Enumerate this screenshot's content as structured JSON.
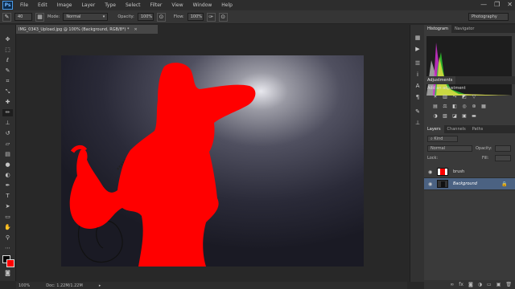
{
  "app": {
    "logo": "Ps"
  },
  "menu": [
    "File",
    "Edit",
    "Image",
    "Layer",
    "Type",
    "Select",
    "Filter",
    "View",
    "Window",
    "Help"
  ],
  "window_controls": {
    "minimize": "—",
    "restore": "❐",
    "close": "✕"
  },
  "options_bar": {
    "brush_size": "40",
    "mode_label": "Mode:",
    "mode_value": "Normal",
    "opacity_label": "Opacity:",
    "opacity_value": "100%",
    "flow_label": "Flow:",
    "flow_value": "100%",
    "workspace": "Photography"
  },
  "document": {
    "tab_title": "IMG_0343_Upload.jpg @ 100% (Background, RGB/8*) *",
    "zoom": "100%",
    "doc_size": "Doc: 1.22M/1.22M"
  },
  "panels": {
    "histogram_tab": "Histogram",
    "navigator_tab": "Navigator",
    "adjustments_tab": "Adjustments",
    "add_adjustment": "Add an adjustment",
    "layers_tab": "Layers",
    "channels_tab": "Channels",
    "paths_tab": "Paths",
    "kind_filter": "Kind",
    "blend_mode": "Normal",
    "opacity_label": "Opacity:",
    "fill_label": "Fill:",
    "lock_label": "Lock:"
  },
  "layers": [
    {
      "name": "brush"
    },
    {
      "name": "Background"
    }
  ],
  "colors": {
    "mask_red": "#ff0000",
    "selected_layer": "#4b6282",
    "panel_bg": "#3a3a3a"
  },
  "icons": {
    "toolbar": [
      "move-icon",
      "marquee-icon",
      "lasso-icon",
      "quick-select-icon",
      "crop-icon",
      "eyedropper-icon",
      "healing-icon",
      "brush-icon",
      "stamp-icon",
      "history-brush-icon",
      "eraser-icon",
      "gradient-icon",
      "blur-icon",
      "dodge-icon",
      "pen-icon",
      "type-icon",
      "path-select-icon",
      "rectangle-icon",
      "hand-icon",
      "zoom-icon"
    ]
  }
}
